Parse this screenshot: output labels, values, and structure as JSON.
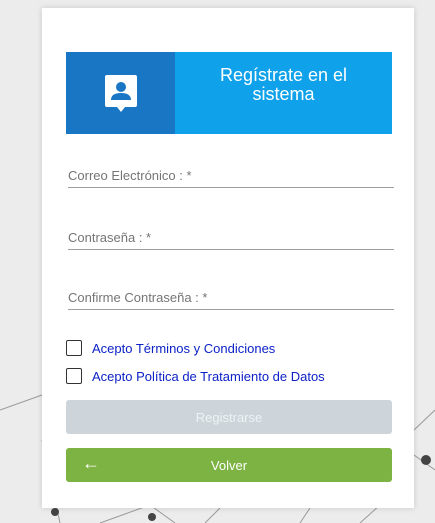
{
  "header": {
    "title": "Regístrate en el sistema"
  },
  "form": {
    "email_label": "Correo Electrónico :  *",
    "password_label": "Contraseña :  *",
    "confirm_password_label": "Confirme Contraseña :  *",
    "terms_label": "Acepto Términos y Condiciones",
    "policy_label": "Acepto Política de Tratamiento de Datos"
  },
  "buttons": {
    "register_label": "Registrarse",
    "back_label": "Volver"
  },
  "colors": {
    "header_dark": "#1876c4",
    "header_light": "#0fa2ea",
    "back_button": "#7cb342",
    "disabled_button": "#cdd5da",
    "link_text": "#0d22c7"
  },
  "icons": {
    "header_icon": "contact-card-icon",
    "back_arrow": "arrow-left-icon"
  }
}
